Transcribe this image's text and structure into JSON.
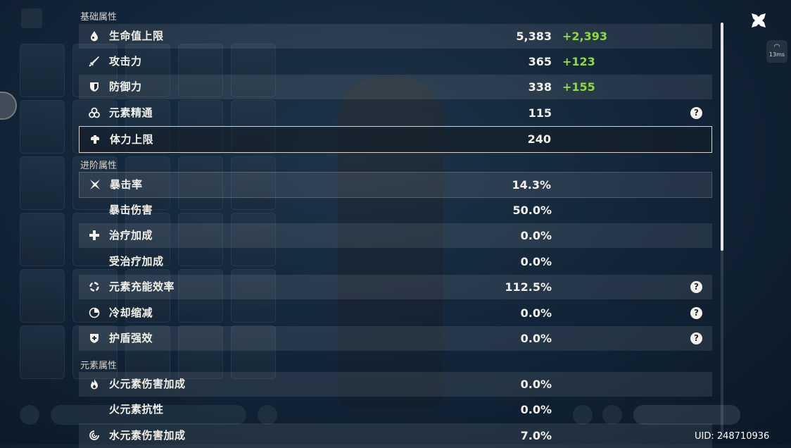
{
  "sections": {
    "base": "基础属性",
    "advanced": "进阶属性",
    "elemental": "元素属性"
  },
  "stats": [
    {
      "label": "生命值上限",
      "value": "5,383",
      "bonus": "+2,393",
      "icon": "hp-drop-icon"
    },
    {
      "label": "攻击力",
      "value": "365",
      "bonus": "+123",
      "icon": "sword-icon"
    },
    {
      "label": "防御力",
      "value": "338",
      "bonus": "+155",
      "icon": "shield-icon"
    },
    {
      "label": "元素精通",
      "value": "115",
      "bonus": "",
      "icon": "elemental-mastery-icon"
    },
    {
      "label": "体力上限",
      "value": "240",
      "bonus": "",
      "icon": "stamina-icon"
    },
    {
      "label": "暴击率",
      "value": "14.3%",
      "bonus": "",
      "icon": "crit-rate-icon"
    },
    {
      "label": "暴击伤害",
      "value": "50.0%",
      "bonus": "",
      "icon": ""
    },
    {
      "label": "治疗加成",
      "value": "0.0%",
      "bonus": "",
      "icon": "healing-cross-icon"
    },
    {
      "label": "受治疗加成",
      "value": "0.0%",
      "bonus": "",
      "icon": ""
    },
    {
      "label": "元素充能效率",
      "value": "112.5%",
      "bonus": "",
      "icon": "energy-recharge-icon"
    },
    {
      "label": "冷却缩减",
      "value": "0.0%",
      "bonus": "",
      "icon": "cooldown-icon"
    },
    {
      "label": "护盾强效",
      "value": "0.0%",
      "bonus": "",
      "icon": "shield-strength-icon"
    },
    {
      "label": "火元素伤害加成",
      "value": "0.0%",
      "bonus": "",
      "icon": "pyro-icon"
    },
    {
      "label": "火元素抗性",
      "value": "0.0%",
      "bonus": "",
      "icon": ""
    },
    {
      "label": "水元素伤害加成",
      "value": "7.0%",
      "bonus": "",
      "icon": "hydro-icon"
    }
  ],
  "help_glyph": "?",
  "network": {
    "latency": "13ms"
  },
  "uid": "UID: 248710936",
  "colors": {
    "bonus": "#8fdb3a",
    "text": "#f3f1ea",
    "accent_border": "#d8d4ca"
  }
}
